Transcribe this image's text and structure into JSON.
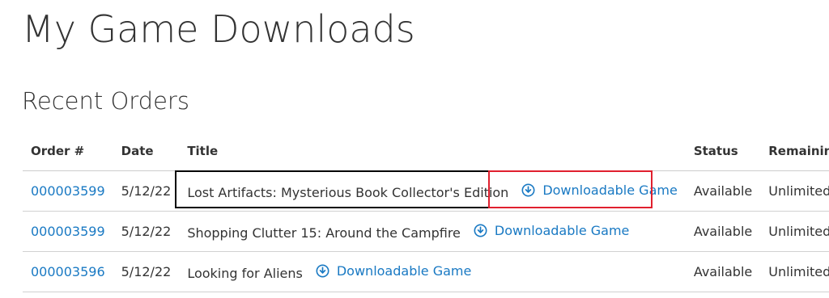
{
  "page": {
    "title": "My Game Downloads"
  },
  "section": {
    "title": "Recent Orders"
  },
  "table": {
    "headers": {
      "order": "Order #",
      "date": "Date",
      "title": "Title",
      "status": "Status",
      "remaining": "Remaining Dow"
    },
    "rows": [
      {
        "order": "000003599",
        "date": "5/12/22",
        "title": "Lost Artifacts: Mysterious Book Collector's Edition",
        "download": "Downloadable Game",
        "status": "Available",
        "remaining": "Unlimited"
      },
      {
        "order": "000003599",
        "date": "5/12/22",
        "title": "Shopping Clutter 15: Around the Campfire",
        "download": "Downloadable Game",
        "status": "Available",
        "remaining": "Unlimited"
      },
      {
        "order": "000003596",
        "date": "5/12/22",
        "title": "Looking for Aliens",
        "download": "Downloadable Game",
        "status": "Available",
        "remaining": "Unlimited"
      }
    ]
  },
  "icons": {
    "download": "download-circle-icon"
  },
  "colors": {
    "link": "#1979c3",
    "text": "#333333",
    "highlight_title": "#000000",
    "highlight_download": "#e0202e"
  }
}
